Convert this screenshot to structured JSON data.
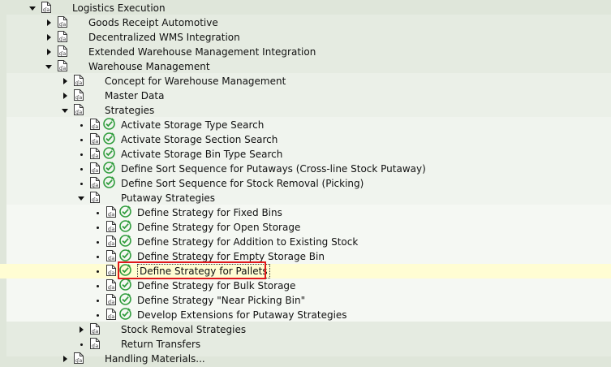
{
  "tree": {
    "items": [
      {
        "label": "Logistics Execution",
        "toggle": "expanded",
        "exec": false
      },
      {
        "label": "Goods Receipt Automotive",
        "toggle": "collapsed",
        "exec": false
      },
      {
        "label": "Decentralized WMS Integration",
        "toggle": "collapsed",
        "exec": false
      },
      {
        "label": "Extended Warehouse Management Integration",
        "toggle": "collapsed",
        "exec": false
      },
      {
        "label": "Warehouse Management",
        "toggle": "expanded",
        "exec": false
      },
      {
        "label": "Concept for Warehouse Management",
        "toggle": "collapsed",
        "exec": false
      },
      {
        "label": "Master Data",
        "toggle": "collapsed",
        "exec": false
      },
      {
        "label": "Strategies",
        "toggle": "expanded",
        "exec": false
      },
      {
        "label": "Activate Storage Type Search",
        "toggle": "leaf",
        "exec": true
      },
      {
        "label": "Activate Storage Section Search",
        "toggle": "leaf",
        "exec": true
      },
      {
        "label": "Activate Storage Bin Type Search",
        "toggle": "leaf",
        "exec": true
      },
      {
        "label": "Define Sort Sequence for Putaways (Cross-line Stock Putaway)",
        "toggle": "leaf",
        "exec": true
      },
      {
        "label": "Define Sort Sequence for Stock Removal (Picking)",
        "toggle": "leaf",
        "exec": true
      },
      {
        "label": "Putaway Strategies",
        "toggle": "expanded",
        "exec": false
      },
      {
        "label": "Define Strategy for Fixed Bins",
        "toggle": "leaf",
        "exec": true
      },
      {
        "label": "Define Strategy for Open Storage",
        "toggle": "leaf",
        "exec": true
      },
      {
        "label": "Define Strategy for Addition to Existing Stock",
        "toggle": "leaf",
        "exec": true
      },
      {
        "label": "Define Strategy for Empty Storage Bin",
        "toggle": "leaf",
        "exec": true
      },
      {
        "label": "Define Strategy for Pallets",
        "toggle": "leaf",
        "exec": true,
        "selected": true
      },
      {
        "label": "Define Strategy for Bulk Storage",
        "toggle": "leaf",
        "exec": true
      },
      {
        "label": "Define Strategy \"Near Picking Bin\"",
        "toggle": "leaf",
        "exec": true
      },
      {
        "label": "Develop Extensions for Putaway Strategies",
        "toggle": "leaf",
        "exec": true
      },
      {
        "label": "Stock Removal Strategies",
        "toggle": "collapsed",
        "exec": false
      },
      {
        "label": "Return Transfers",
        "toggle": "leaf",
        "exec": false
      },
      {
        "label": "Handling Materials...",
        "toggle": "collapsed",
        "exec": false
      }
    ]
  },
  "colors": {
    "band1": "#dfe6da",
    "band2": "#e5ebe1",
    "band3": "#ebf0e8",
    "band4": "#f0f4ee",
    "selected_row": "#fffdd3",
    "highlight_box": "#e0191b",
    "exec_icon": "#2f9c3c"
  }
}
